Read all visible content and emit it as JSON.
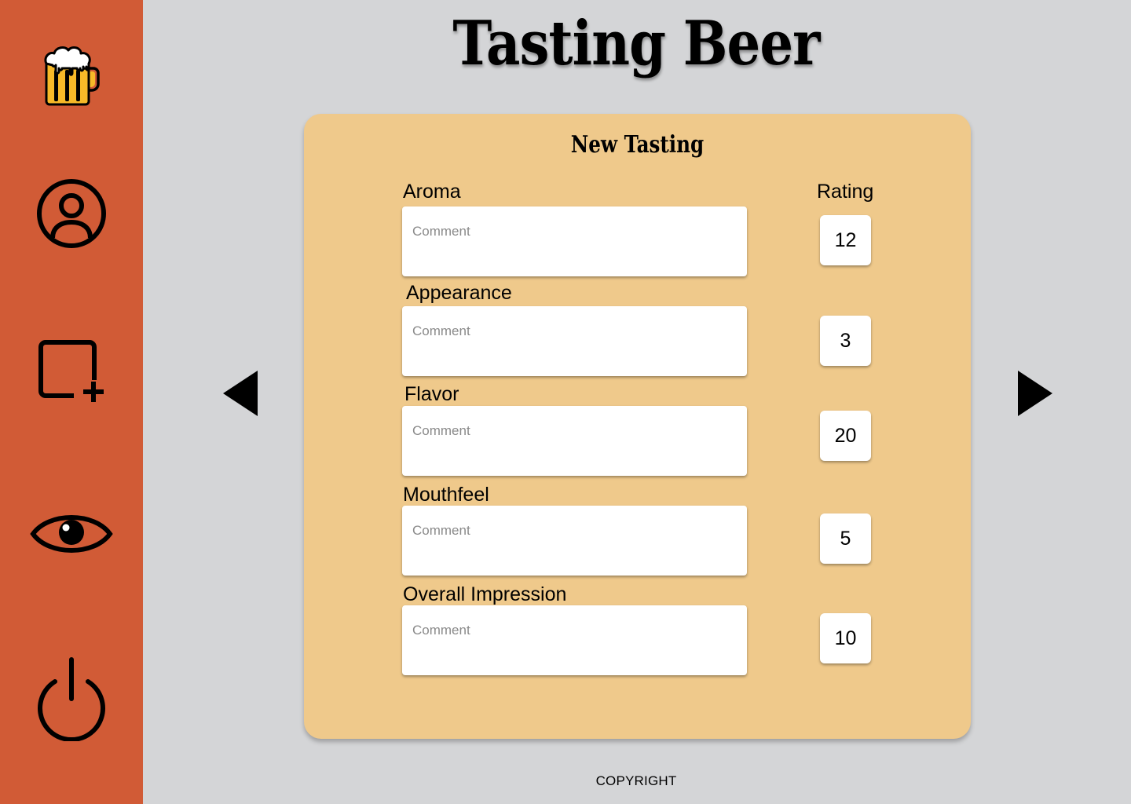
{
  "app": {
    "title": "Tasting Beer",
    "footer": "COPYRIGHT"
  },
  "colors": {
    "sidebar": "#d15b36",
    "background": "#d4d5d7",
    "card": "#efc98b",
    "beer": "#f7b928"
  },
  "sidebar": {
    "items": [
      {
        "icon": "beer-mug-icon"
      },
      {
        "icon": "user-profile-icon"
      },
      {
        "icon": "add-square-icon"
      },
      {
        "icon": "eye-icon"
      },
      {
        "icon": "power-icon"
      }
    ]
  },
  "form": {
    "title": "New Tasting",
    "rating_header": "Rating",
    "fields": [
      {
        "label": "Aroma",
        "placeholder": "Comment",
        "rating": "12"
      },
      {
        "label": "Appearance",
        "placeholder": "Comment",
        "rating": "3"
      },
      {
        "label": "Flavor",
        "placeholder": "Comment",
        "rating": "20"
      },
      {
        "label": "Mouthfeel",
        "placeholder": "Comment",
        "rating": "5"
      },
      {
        "label": "Overall Impression",
        "placeholder": "Comment",
        "rating": "10"
      }
    ]
  },
  "navigation": {
    "prev_icon": "arrow-left-icon",
    "next_icon": "arrow-right-icon"
  }
}
